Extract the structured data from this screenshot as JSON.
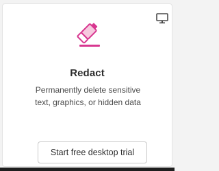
{
  "card": {
    "title": "Redact",
    "description_line1": "Permanently delete sensitive",
    "description_line2": "text, graphics, or hidden data",
    "button_label": "Start free desktop trial",
    "tool_icon": "marker-eraser-icon",
    "badge_icon": "desktop-monitor-icon"
  },
  "colors": {
    "accent": "#d83790",
    "title": "#2c2c2c",
    "description": "#4b4b4b"
  }
}
